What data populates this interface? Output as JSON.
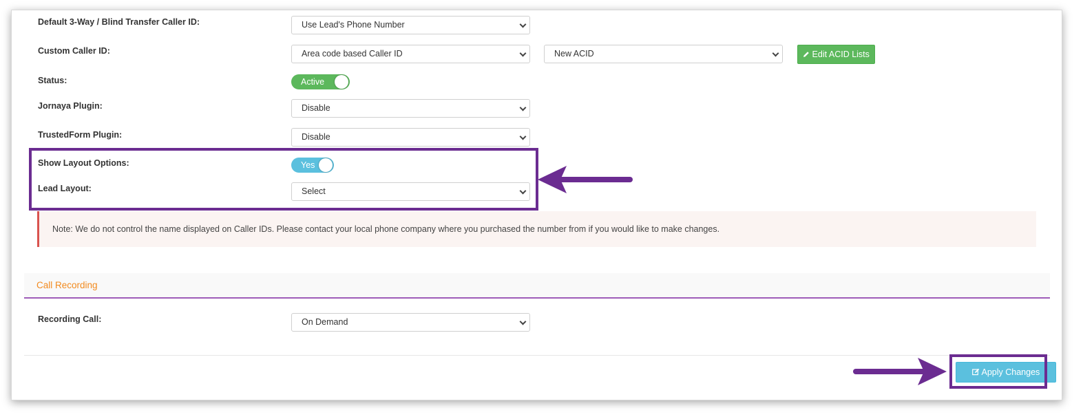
{
  "fields": {
    "transfer_caller_id": {
      "label": "Default 3-Way / Blind Transfer Caller ID:",
      "value": "Use Lead's Phone Number"
    },
    "custom_caller_id": {
      "label": "Custom Caller ID:",
      "value": "Area code based Caller ID",
      "acid_value": "New ACID",
      "edit_button": "Edit ACID Lists"
    },
    "status": {
      "label": "Status:",
      "toggle_text": "Active"
    },
    "jornaya": {
      "label": "Jornaya Plugin:",
      "value": "Disable"
    },
    "trustedform": {
      "label": "TrustedForm Plugin:",
      "value": "Disable"
    },
    "show_layout": {
      "label": "Show Layout Options:",
      "toggle_text": "Yes"
    },
    "lead_layout": {
      "label": "Lead Layout:",
      "value": "Select"
    }
  },
  "note": "Note: We do not control the name displayed on Caller IDs. Please contact your local phone company where you purchased the number from if you would like to make changes.",
  "recording": {
    "section_title": "Call Recording",
    "label": "Recording Call:",
    "value": "On Demand"
  },
  "footer": {
    "apply_button": "Apply Changes"
  },
  "colors": {
    "green": "#5cb85c",
    "blue": "#5bc0de",
    "toggle_blue": "#5bc0de",
    "highlight_purple": "#6b2c91",
    "section_orange": "#f28a1e"
  }
}
